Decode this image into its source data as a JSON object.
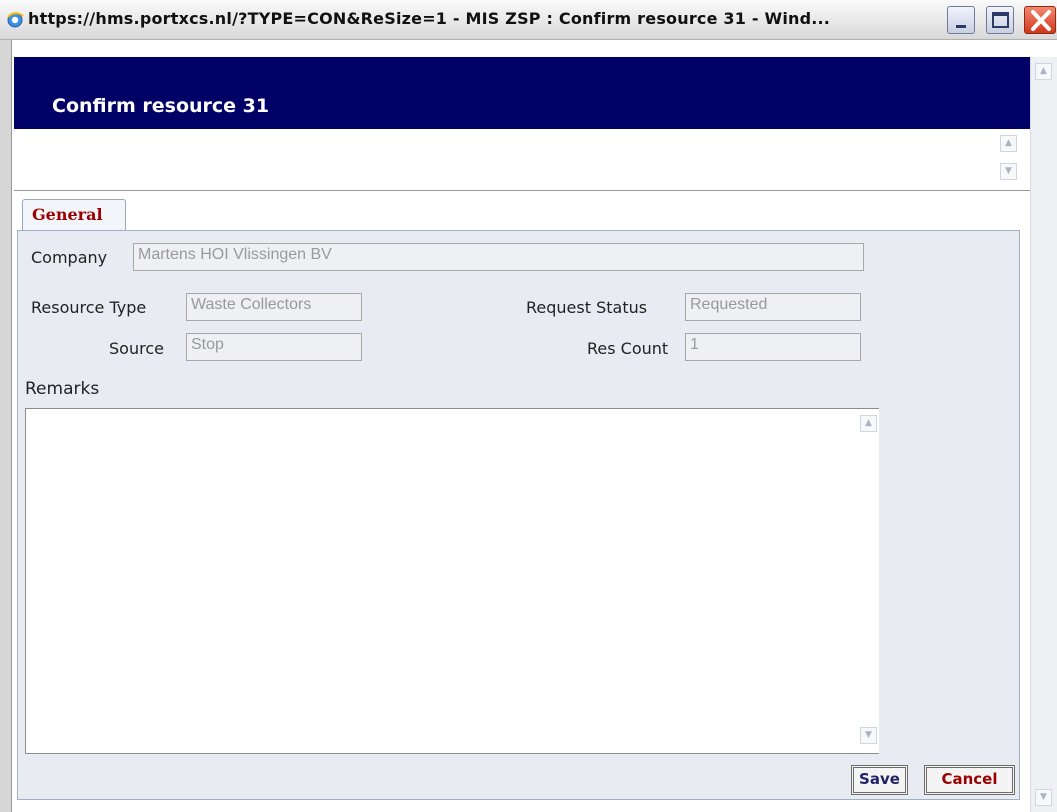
{
  "window": {
    "title": "https://hms.portxcs.nl/?TYPE=CON&ReSize=1 - MIS ZSP : Confirm resource 31 - Wind..."
  },
  "header": {
    "title": "Confirm resource 31"
  },
  "tabs": [
    {
      "label": "General",
      "active": true
    }
  ],
  "form": {
    "company": {
      "label": "Company",
      "value": "Martens HOI Vlissingen BV"
    },
    "resource_type": {
      "label": "Resource Type",
      "value": "Waste Collectors"
    },
    "request_status": {
      "label": "Request Status",
      "value": "Requested"
    },
    "source": {
      "label": "Source",
      "value": "Stop"
    },
    "res_count": {
      "label": "Res Count",
      "value": "1"
    },
    "remarks": {
      "label": "Remarks",
      "value": ""
    }
  },
  "buttons": {
    "save": "Save",
    "cancel": "Cancel"
  },
  "colors": {
    "header_bg": "#000066",
    "tab_text": "#990000",
    "panel_bg": "#e8ecf2"
  }
}
